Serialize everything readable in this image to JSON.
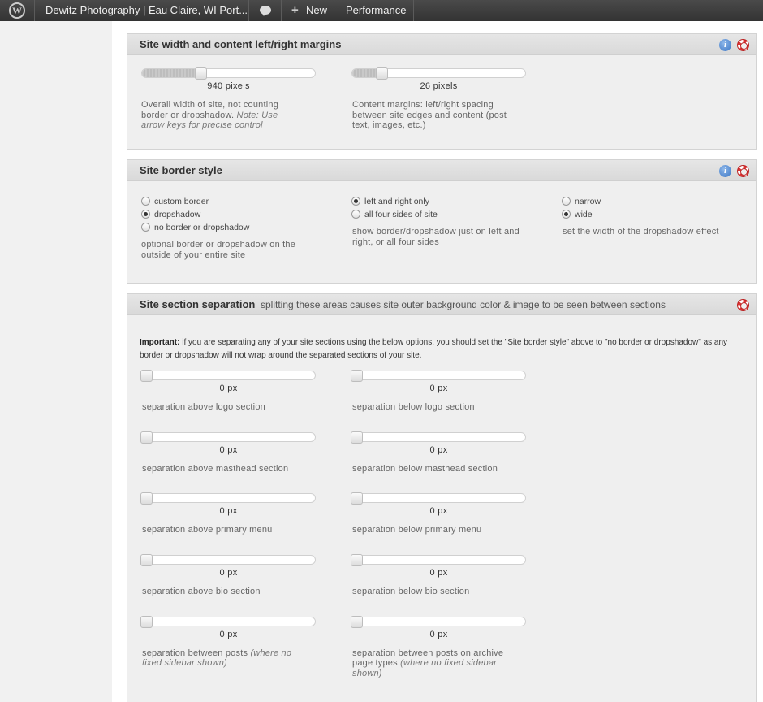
{
  "adminbar": {
    "site_title": "Dewitz Photography | Eau Claire, WI Port...",
    "new_label": "New",
    "performance_label": "Performance",
    "icons": [
      "wordpress-logo-icon",
      "comment-bubble-icon",
      "plus-icon"
    ]
  },
  "width_panel": {
    "title": "Site width and content left/right margins",
    "site_width": {
      "value_label": "940 pixels",
      "fill_fraction": 0.34,
      "description": "Overall width of site, not counting border or dropshadow.",
      "note": "Note: Use arrow keys for precise control"
    },
    "content_margins": {
      "value_label": "26 pixels",
      "fill_fraction": 0.17,
      "description": "Content margins: left/right spacing between site edges and content (post text, images, etc.)"
    }
  },
  "border_panel": {
    "title": "Site border style",
    "style_options": [
      "custom border",
      "dropshadow",
      "no border or dropshadow"
    ],
    "style_selected": "dropshadow",
    "style_description": "optional border or dropshadow on the outside of your entire site",
    "sides_options": [
      "left and right only",
      "all four sides of site"
    ],
    "sides_selected": "left and right only",
    "sides_description": "show border/dropshadow just on left and right, or all four sides",
    "width_options": [
      "narrow",
      "wide"
    ],
    "width_selected": "wide",
    "width_description": "set the width of the dropshadow effect"
  },
  "separation_panel": {
    "title": "Site section separation",
    "subtitle": "splitting these areas causes site outer background color & image to be seen between sections",
    "important_label": "Important:",
    "important_text": "if you are separating any of your site sections using the below options, you should set the \"Site border style\" above to \"no border or dropshadow\" as any border or dropshadow will not wrap around the separated sections of your site.",
    "rows": [
      {
        "left_value": "0 px",
        "left_label": "separation above logo section",
        "right_value": "0 px",
        "right_label": "separation below logo section"
      },
      {
        "left_value": "0 px",
        "left_label": "separation above masthead section",
        "right_value": "0 px",
        "right_label": "separation below masthead section"
      },
      {
        "left_value": "0 px",
        "left_label": "separation above primary menu",
        "right_value": "0 px",
        "right_label": "separation below primary menu"
      },
      {
        "left_value": "0 px",
        "left_label": "separation above bio section",
        "right_value": "0 px",
        "right_label": "separation below bio section"
      },
      {
        "left_value": "0 px",
        "left_label": "separation between posts",
        "left_note": "(where no fixed sidebar shown)",
        "right_value": "0 px",
        "right_label": "separation between posts on archive page types",
        "right_note": "(where no fixed sidebar shown)"
      }
    ]
  }
}
